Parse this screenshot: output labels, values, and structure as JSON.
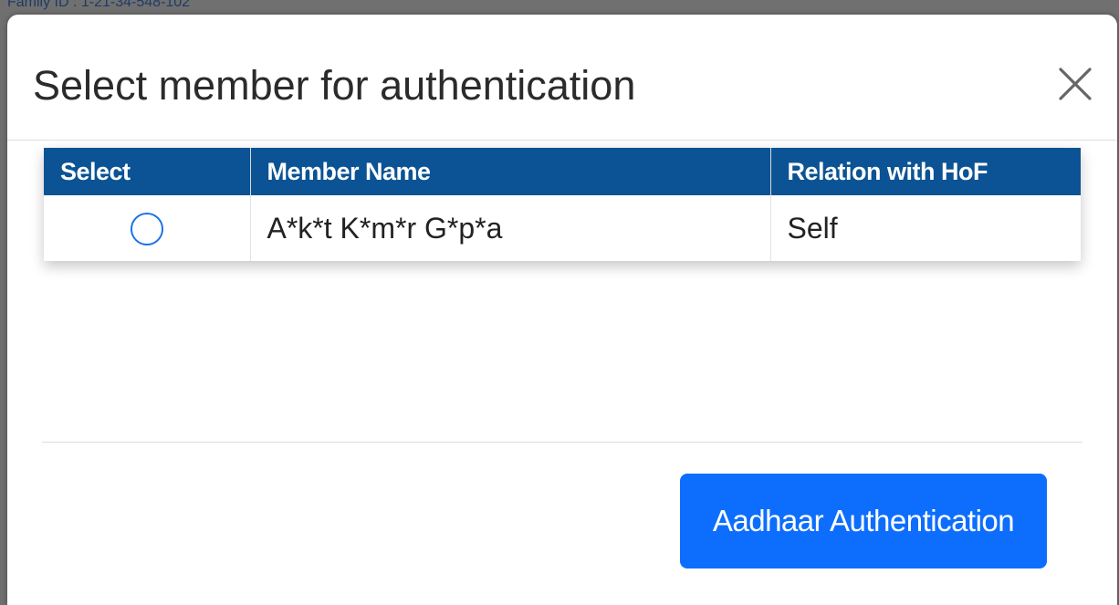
{
  "backdrop": {
    "partial_text": "Family ID : 1-21-34-548-102"
  },
  "modal": {
    "title": "Select member for authentication",
    "close_icon": "close-icon"
  },
  "table": {
    "columns": [
      "Select",
      "Member Name",
      "Relation with HoF"
    ],
    "rows": [
      {
        "selected": false,
        "member_name": "A*k*t K*m*r G*p*a",
        "relation": "Self"
      }
    ]
  },
  "footer": {
    "button_label": "Aadhaar Authentication"
  },
  "colors": {
    "header_bg": "#0b5394",
    "button_bg": "#0d6efd",
    "radio_border": "#1a73e8"
  }
}
